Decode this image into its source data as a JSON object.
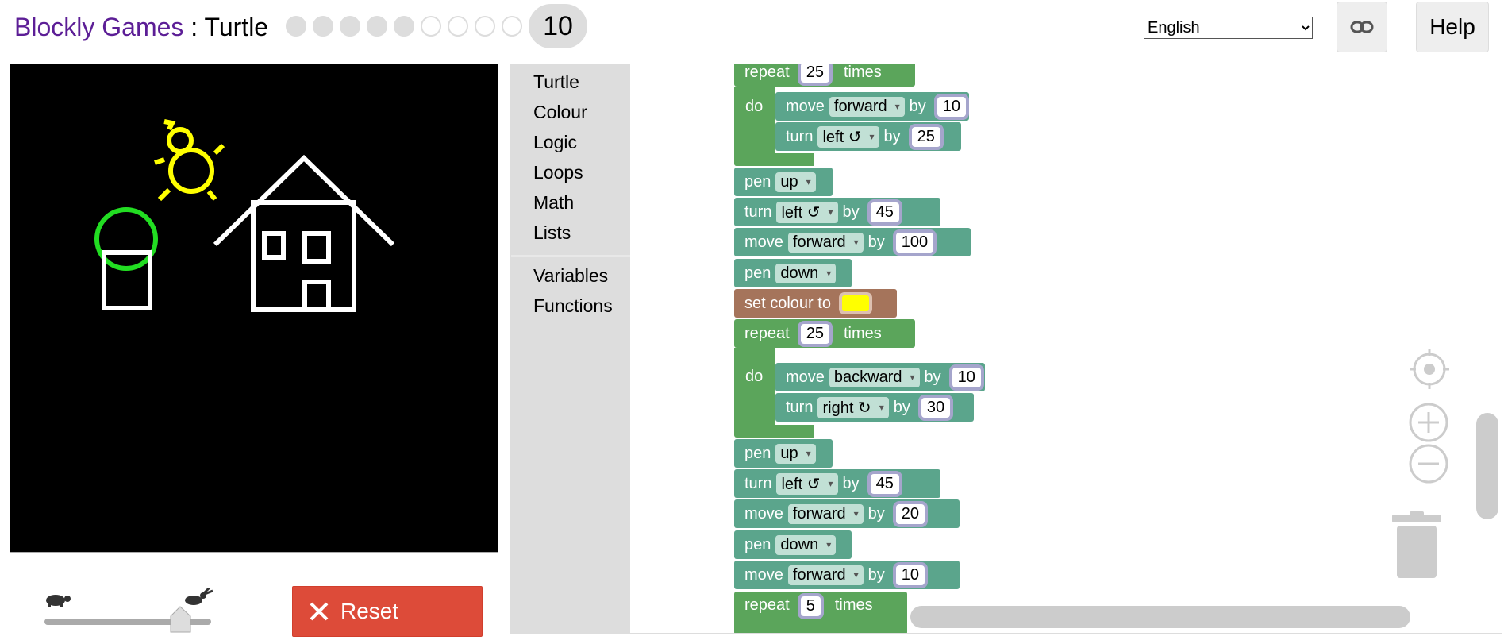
{
  "header": {
    "app_name": "Blockly Games",
    "separator": " : ",
    "page_name": "Turtle",
    "levels_completed": 5,
    "levels_total": 9,
    "current_level": "10",
    "language": "English",
    "help_label": "Help"
  },
  "controls": {
    "reset_label": "Reset"
  },
  "toolbox": {
    "categories": [
      "Turtle",
      "Colour",
      "Logic",
      "Loops",
      "Math",
      "Lists"
    ],
    "categories2": [
      "Variables",
      "Functions"
    ]
  },
  "blocks": {
    "repeat1": {
      "kw": "repeat",
      "times": "25",
      "times_label": "times",
      "do": "do"
    },
    "move1": {
      "kw": "move",
      "dir": "forward",
      "by": "by",
      "val": "10"
    },
    "turn1": {
      "kw": "turn",
      "dir": "left ↺",
      "by": "by",
      "val": "25"
    },
    "pen1": {
      "kw": "pen",
      "state": "up"
    },
    "turn2": {
      "kw": "turn",
      "dir": "left ↺",
      "by": "by",
      "val": "45"
    },
    "move2": {
      "kw": "move",
      "dir": "forward",
      "by": "by",
      "val": "100"
    },
    "pen2": {
      "kw": "pen",
      "state": "down"
    },
    "colour": {
      "kw": "set colour to",
      "colour": "#ffff00"
    },
    "repeat2": {
      "kw": "repeat",
      "times": "25",
      "times_label": "times",
      "do": "do"
    },
    "move3": {
      "kw": "move",
      "dir": "backward",
      "by": "by",
      "val": "10"
    },
    "turn3": {
      "kw": "turn",
      "dir": "right ↻",
      "by": "by",
      "val": "30"
    },
    "pen3": {
      "kw": "pen",
      "state": "up"
    },
    "turn4": {
      "kw": "turn",
      "dir": "left ↺",
      "by": "by",
      "val": "45"
    },
    "move4": {
      "kw": "move",
      "dir": "forward",
      "by": "by",
      "val": "20"
    },
    "pen4": {
      "kw": "pen",
      "state": "down"
    },
    "move5": {
      "kw": "move",
      "dir": "forward",
      "by": "by",
      "val": "10"
    },
    "repeat3": {
      "kw": "repeat",
      "times": "5",
      "times_label": "times"
    }
  },
  "colors": {
    "turtle_block": "#5ba58c",
    "loop_block": "#5ba55b",
    "colour_block": "#a5745b",
    "reset": "#dd4b39",
    "title_link": "#5c1e96"
  }
}
